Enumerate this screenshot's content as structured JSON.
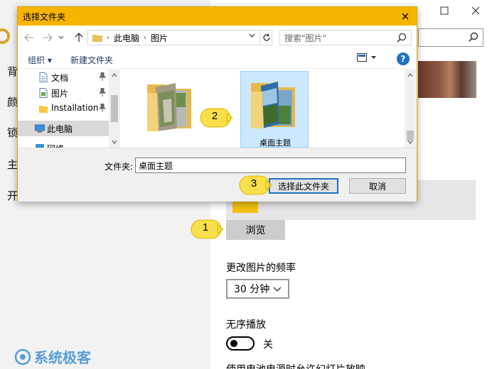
{
  "settings": {
    "sidebar_chars": [
      "背",
      "颜",
      "锁",
      "主",
      "开"
    ],
    "browse_label": "浏览",
    "frequency_label": "更改图片的频率",
    "frequency_value": "30 分钟",
    "shuffle_label": "无序播放",
    "shuffle_state": "关",
    "cut_text": "使用电池电源时允许幻灯片放映"
  },
  "dialog": {
    "title": "选择文件夹",
    "breadcrumb": [
      "此电脑",
      "图片"
    ],
    "search_placeholder": "搜索\"图片\"",
    "organize_label": "组织 ▾",
    "new_folder_label": "新建文件夹",
    "help_label": "?",
    "nav_items": [
      {
        "label": "文档"
      },
      {
        "label": "图片"
      },
      {
        "label": "Installation"
      },
      {
        "label": "此电脑"
      },
      {
        "label": "网络"
      }
    ],
    "folders": [
      {
        "label": ""
      },
      {
        "label": "桌面主题"
      }
    ],
    "filename_label": "文件夹:",
    "filename_value": "桌面主题",
    "select_label": "选择此文件夹",
    "cancel_label": "取消"
  },
  "callouts": [
    "1",
    "2",
    "3"
  ],
  "watermark": "系统极客",
  "colors": {
    "dialog_title": "#f8b500",
    "accent": "#1f70c1",
    "callout": "#f9e04b",
    "selected_tile": "#cce8ff",
    "watermark": "#3f8fd2"
  }
}
